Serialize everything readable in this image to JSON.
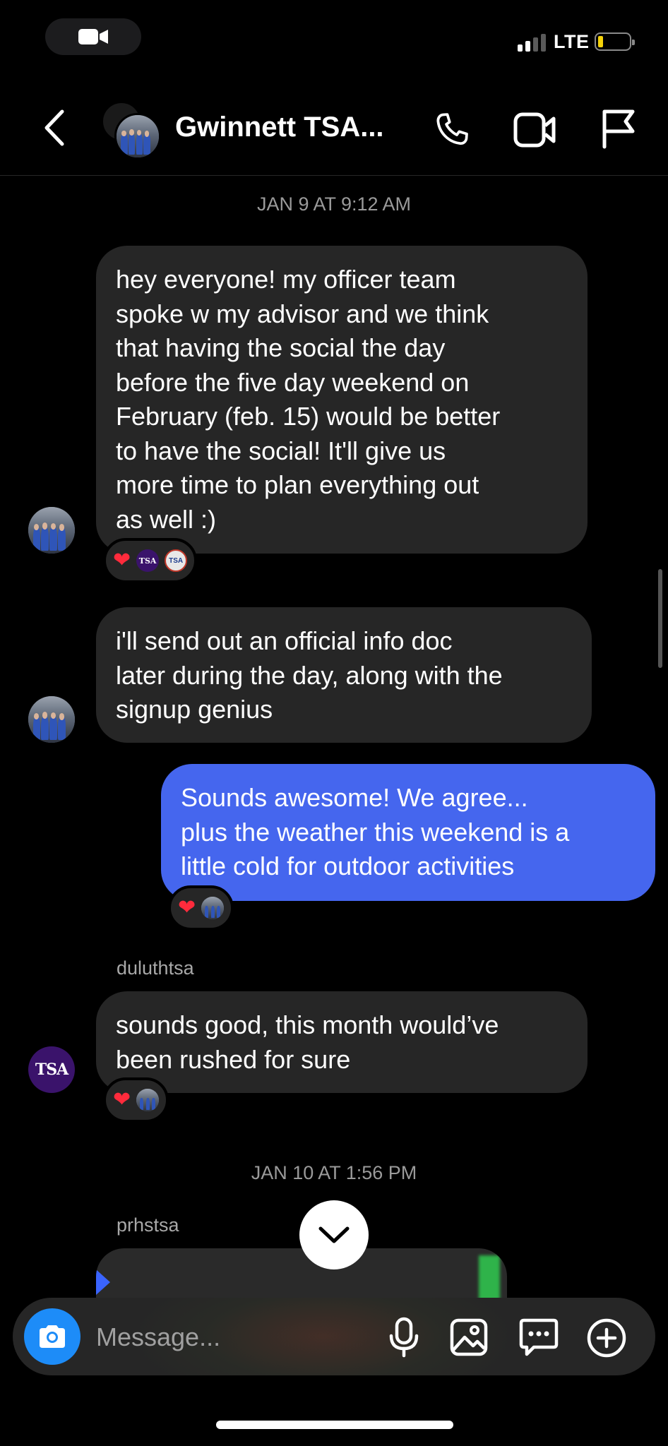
{
  "status_bar": {
    "network": "LTE"
  },
  "header": {
    "title": "Gwinnett TSA...",
    "icons": [
      "back-chevron-icon",
      "group-avatar",
      "phone-icon",
      "video-call-icon",
      "flag-icon"
    ]
  },
  "thread": {
    "timestamps": [
      "JAN 9 AT 9:12 AM",
      "JAN 10 AT 1:56 PM"
    ],
    "messages": [
      {
        "lines": [
          "hey everyone! my officer team",
          "spoke w my advisor and we think",
          "that having the social the day",
          "before the five day weekend on",
          "February (feb. 15) would be better",
          "to have the social! It'll give us",
          "more time to plan everything out",
          "as well :)"
        ],
        "reactions": [
          "heart",
          "tsa-avatar",
          "tsa-badge-avatar"
        ]
      },
      {
        "lines": [
          "i'll send out an official info doc",
          "later during the day, along with the",
          "signup genius"
        ]
      },
      {
        "lines": [
          "Sounds awesome! We agree...",
          "plus the weather this weekend is a",
          "little cold for outdoor activities"
        ],
        "reactions": [
          "heart",
          "group-avatar"
        ]
      },
      {
        "sender": "duluthtsa",
        "lines": [
          "sounds good, this month would’ve",
          "been rushed for sure"
        ],
        "reactions": [
          "heart",
          "group-avatar"
        ]
      },
      {
        "sender": "prhstsa"
      }
    ]
  },
  "avatar_texts": {
    "tsa": "TSA",
    "tsa_mini": "TSA"
  },
  "composer": {
    "placeholder": "Message..."
  },
  "colors": {
    "my_bubble": "#4566ee",
    "their_bubble": "#262626",
    "camera_button": "#1d8cf8",
    "heart": "#ff2b3c"
  }
}
